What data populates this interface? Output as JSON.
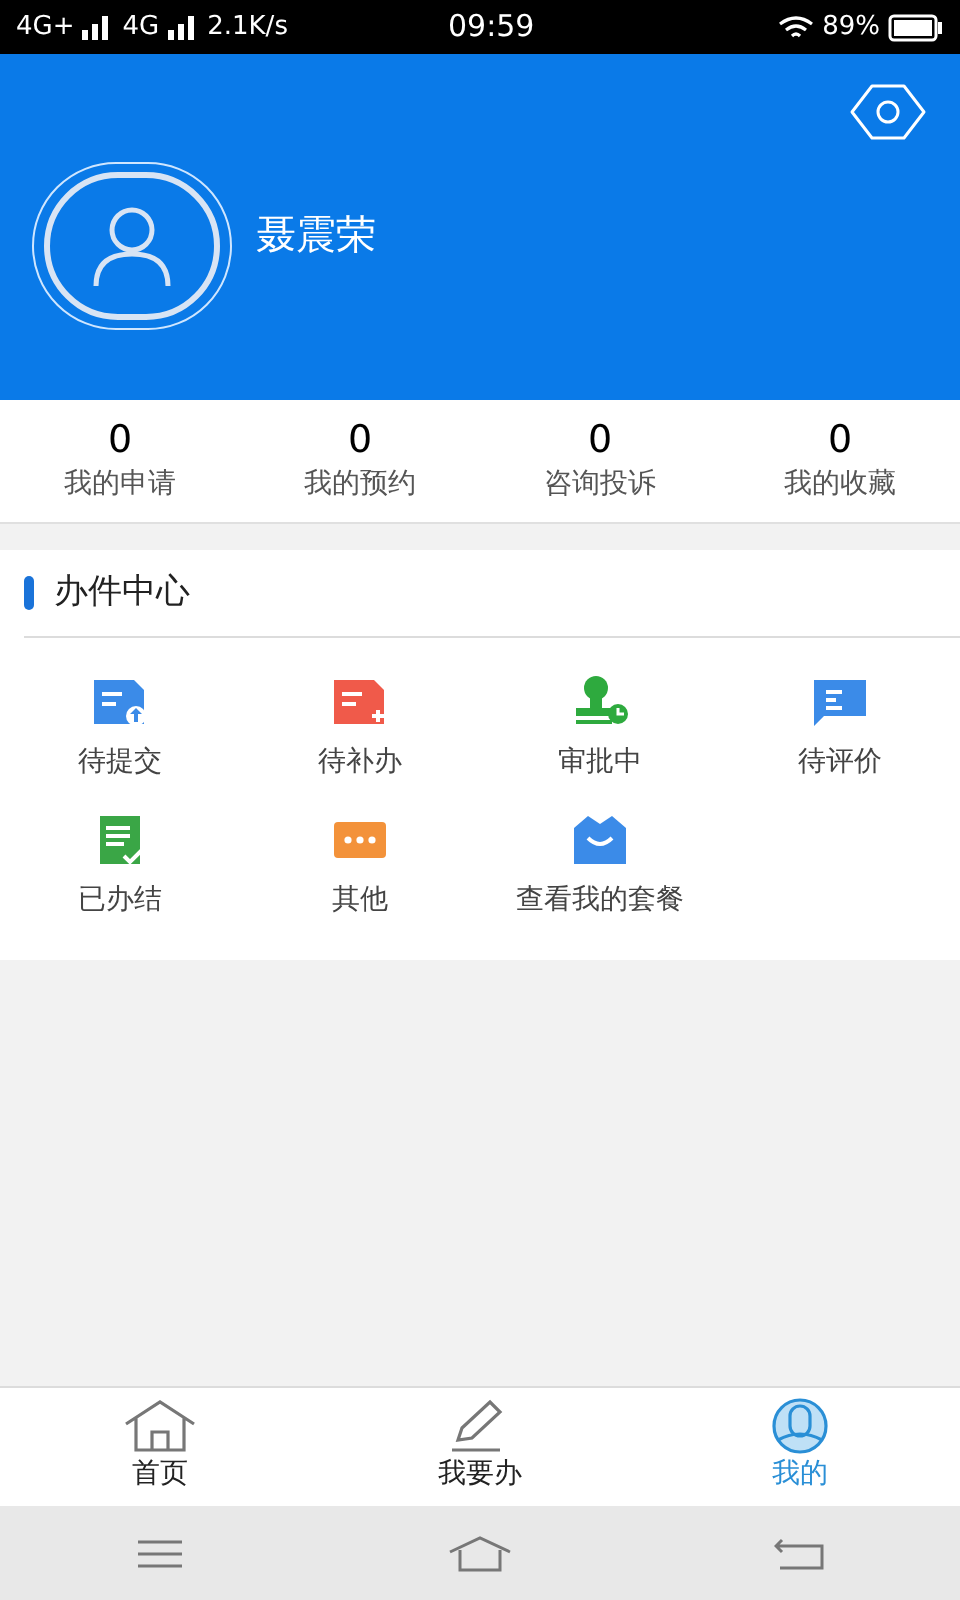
{
  "status_bar": {
    "carrier_1": "4G+",
    "carrier_2": "4G",
    "speed": "2.1K/s",
    "time": "09:59",
    "battery": "89%"
  },
  "profile": {
    "name": "聂震荣"
  },
  "stats": [
    {
      "value": "0",
      "label": "我的申请"
    },
    {
      "value": "0",
      "label": "我的预约"
    },
    {
      "value": "0",
      "label": "咨询投诉"
    },
    {
      "value": "0",
      "label": "我的收藏"
    }
  ],
  "section": {
    "title": "办件中心",
    "items": [
      {
        "kind": "upload",
        "label": "待提交"
      },
      {
        "kind": "add",
        "label": "待补办"
      },
      {
        "kind": "stamp",
        "label": "审批中"
      },
      {
        "kind": "chat",
        "label": "待评价"
      },
      {
        "kind": "done",
        "label": "已办结"
      },
      {
        "kind": "more",
        "label": "其他"
      },
      {
        "kind": "bag",
        "label": "查看我的套餐"
      }
    ]
  },
  "tab_bar": [
    {
      "kind": "home",
      "label": "首页",
      "selected": false
    },
    {
      "kind": "edit",
      "label": "我要办",
      "selected": false
    },
    {
      "kind": "me",
      "label": "我的",
      "selected": true
    }
  ]
}
